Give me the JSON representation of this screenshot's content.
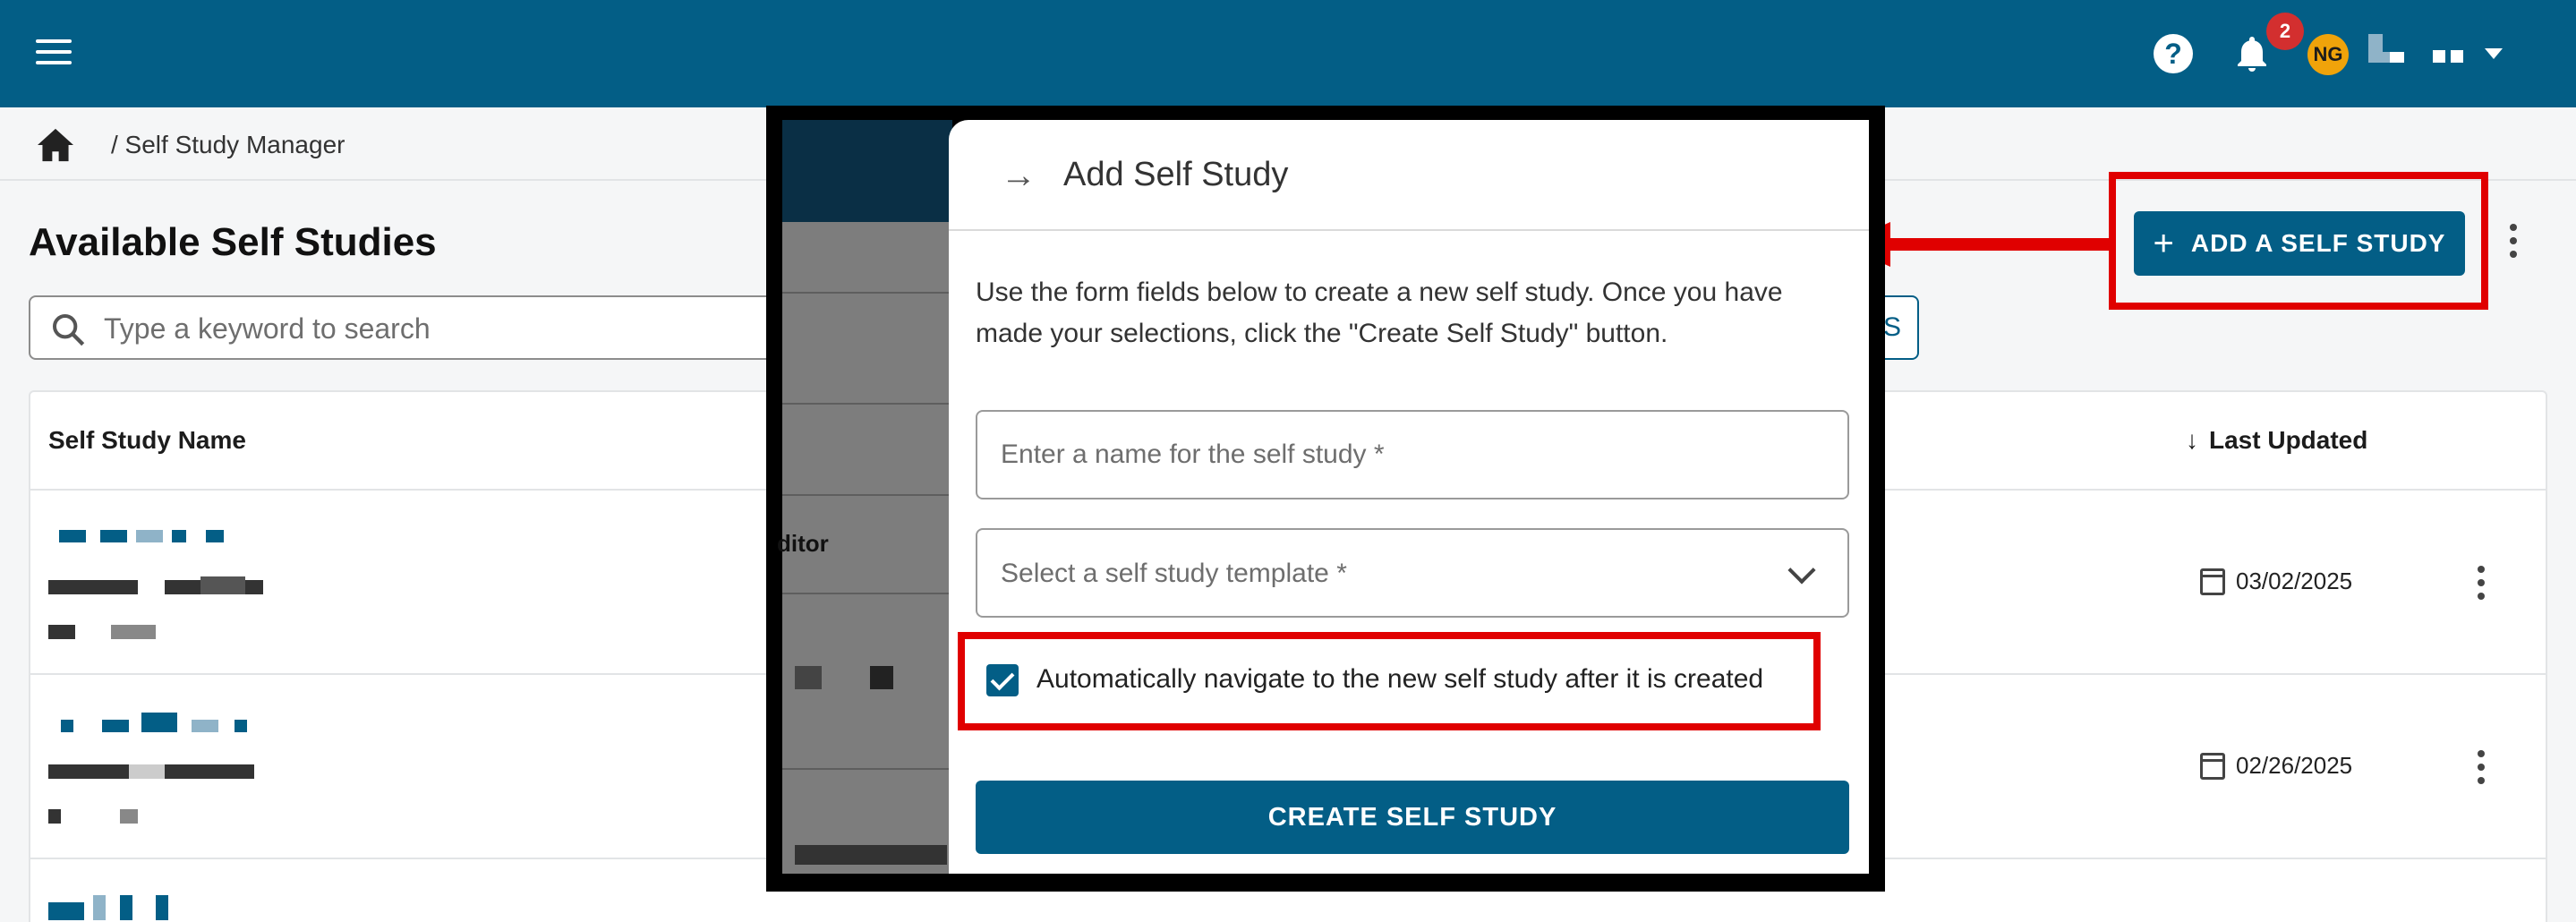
{
  "header": {
    "notification_count": "2",
    "avatar_initials": "NG"
  },
  "breadcrumb": {
    "current": "/ Self Study Manager"
  },
  "page": {
    "title": "Available Self Studies",
    "search_placeholder": "Type a keyword to search",
    "filters_fragment": "S",
    "add_button_label": "ADD A SELF STUDY"
  },
  "table": {
    "columns": [
      "Self Study Name",
      "Last Updated"
    ],
    "rows": [
      {
        "last_updated": "03/02/2025"
      },
      {
        "last_updated": "02/26/2025"
      }
    ],
    "partial_column_text": "ditor"
  },
  "drawer": {
    "title": "Add Self Study",
    "description": "Use the form fields below to create a new self study. Once you have made your selections, click the \"Create Self Study\" button.",
    "name_placeholder": "Enter a name for the self study *",
    "template_placeholder": "Select a self study template *",
    "auto_navigate_label": "Automatically navigate to the new self study after it is created",
    "auto_navigate_checked": true,
    "create_button_label": "CREATE SELF STUDY"
  },
  "colors": {
    "brand": "#035e86",
    "highlight": "#e00000",
    "badge": "#d32f2f",
    "avatar": "#f0a30a"
  },
  "icons": [
    "menu-icon",
    "help-icon",
    "bell-icon",
    "home-icon",
    "search-icon",
    "plus-icon",
    "more-vert-icon",
    "arrow-down-icon",
    "calendar-icon",
    "arrow-right-icon",
    "chevron-down-icon",
    "checkbox-checked-icon"
  ]
}
